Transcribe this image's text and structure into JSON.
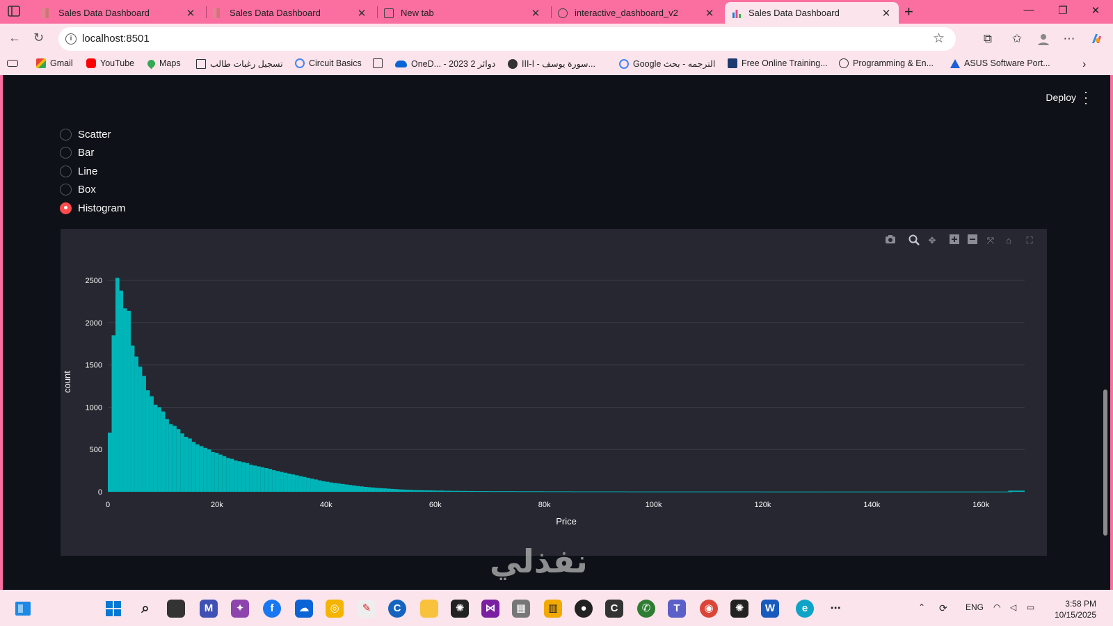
{
  "browser": {
    "tabs": [
      {
        "label": "Sales Data Dashboard",
        "active": false
      },
      {
        "label": "Sales Data Dashboard",
        "active": false
      },
      {
        "label": "New tab",
        "active": false
      },
      {
        "label": "interactive_dashboard_v2",
        "active": false
      },
      {
        "label": "Sales Data Dashboard",
        "active": true
      }
    ],
    "url": "localhost:8501",
    "bookmarks": [
      "Gmail",
      "YouTube",
      "Maps",
      "تسجيل رغبات طالب",
      "Circuit Basics",
      "OneD... - 2023 دوائر 2",
      "سورة يوسف - ا-ااا...",
      "Google الترجمه - بحث",
      "Free Online Training...",
      "Programming & En...",
      "ASUS Software Port..."
    ]
  },
  "app": {
    "deploy_label": "Deploy",
    "radio_options": [
      "Scatter",
      "Bar",
      "Line",
      "Box",
      "Histogram"
    ],
    "selected_option": "Histogram",
    "accent_color": "#ff4b4b",
    "watermark": "نفذلي"
  },
  "chart_data": {
    "type": "histogram",
    "xlabel": "Price",
    "ylabel": "count",
    "x_tick_labels": [
      "0",
      "20k",
      "40k",
      "60k",
      "80k",
      "100k",
      "120k",
      "140k",
      "160k"
    ],
    "y_tick_labels": [
      "0",
      "500",
      "1000",
      "1500",
      "2000",
      "2500"
    ],
    "xlim": [
      0,
      168000
    ],
    "ylim": [
      0,
      2600
    ],
    "bin_width": 700,
    "bar_color": "#00b5b8",
    "grid": true,
    "bins_x": [
      0,
      700,
      1400,
      2100,
      2800,
      3500,
      4200,
      4900,
      5600,
      6300,
      7000,
      7700,
      8400,
      9100,
      9800,
      10500,
      11200,
      11900,
      12600,
      13300,
      14000,
      14700,
      15400,
      16100,
      16800,
      17500,
      18200,
      18900,
      19600,
      20300,
      21000,
      21700,
      22400,
      23100,
      23800,
      24500,
      25200,
      25900,
      26600,
      27300,
      28000,
      28700,
      29400,
      30100,
      30800,
      31500,
      32200,
      32900,
      33600,
      34300,
      35000,
      35700,
      36400,
      37100,
      37800,
      38500,
      39200,
      39900,
      40600,
      41300,
      42000,
      42700,
      43400,
      44100,
      44800,
      45500,
      46200,
      46900,
      47600,
      48300,
      49000,
      49700,
      50400,
      51100,
      51800,
      52500,
      53200,
      53900,
      54600,
      55300,
      56000,
      56700,
      57400,
      58100,
      58800,
      59500,
      60200,
      61600,
      63000,
      64400,
      65800,
      67200,
      70000,
      75000,
      80000,
      85000,
      90000,
      95000,
      100000,
      110000,
      120000,
      130000,
      140000,
      150000,
      160000,
      165000
    ],
    "counts": [
      700,
      1850,
      2530,
      2380,
      2170,
      2140,
      1730,
      1600,
      1480,
      1370,
      1200,
      1130,
      1030,
      1000,
      950,
      860,
      800,
      780,
      740,
      690,
      650,
      630,
      590,
      560,
      540,
      520,
      500,
      470,
      460,
      440,
      420,
      400,
      390,
      370,
      360,
      350,
      340,
      320,
      310,
      300,
      290,
      280,
      270,
      255,
      245,
      235,
      225,
      215,
      205,
      195,
      185,
      175,
      165,
      155,
      145,
      135,
      125,
      118,
      110,
      104,
      98,
      92,
      86,
      80,
      74,
      68,
      63,
      58,
      54,
      50,
      46,
      43,
      40,
      37,
      34,
      31,
      28,
      26,
      24,
      22,
      20,
      19,
      18,
      17,
      16,
      15,
      14,
      12,
      11,
      10,
      9,
      8,
      7,
      6,
      5,
      4,
      4,
      3,
      3,
      3,
      2,
      2,
      2,
      2,
      2,
      2
    ]
  },
  "taskbar": {
    "language": "ENG",
    "time": "3:58 PM",
    "date": "10/15/2025"
  }
}
